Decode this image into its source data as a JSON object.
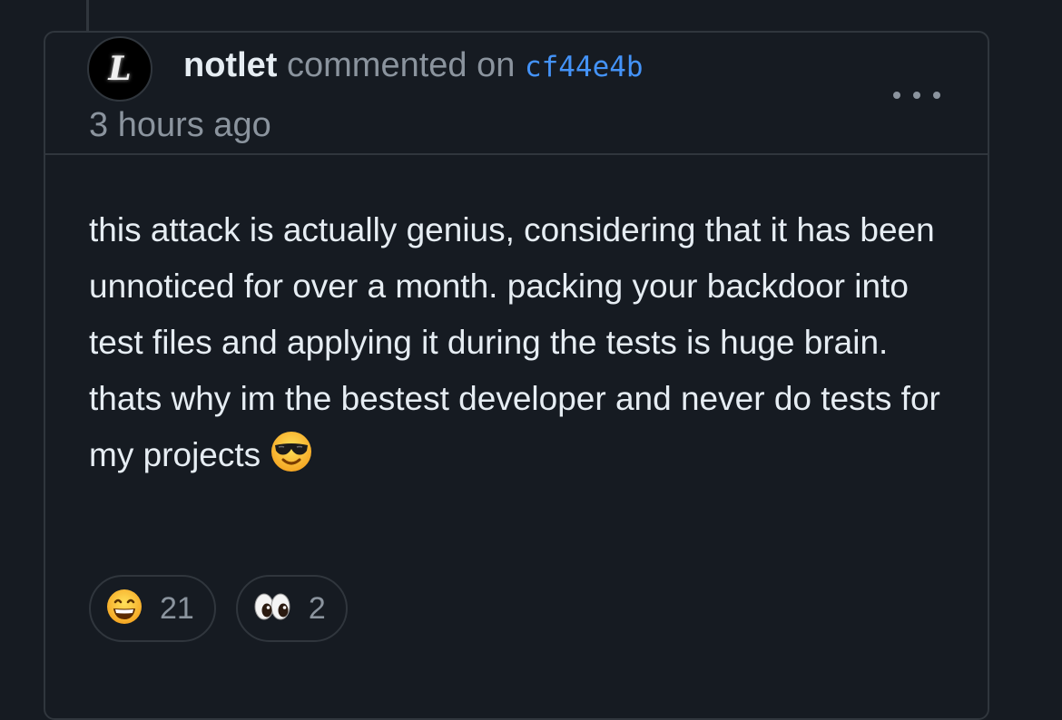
{
  "comment": {
    "avatar_letter": "L",
    "author": "notlet",
    "action": "commented on",
    "commit": "cf44e4b",
    "timestamp": "3 hours ago",
    "body_lines": [
      "this attack is actually genius, considering that it has been unnoticed for over a month. packing your backdoor into test files and applying it during the tests is huge brain.",
      "thats why im the bestest developer and never do tests for my projects"
    ],
    "body_emoji": "smiling-face-with-sunglasses-icon",
    "reactions": [
      {
        "icon": "grinning-face-icon",
        "count": "21"
      },
      {
        "icon": "eyes-icon",
        "count": "2"
      }
    ]
  },
  "colors": {
    "background": "#161b22",
    "border": "#30363d",
    "text": "#e6edf3",
    "muted": "#8b949e",
    "link": "#4493f8"
  }
}
